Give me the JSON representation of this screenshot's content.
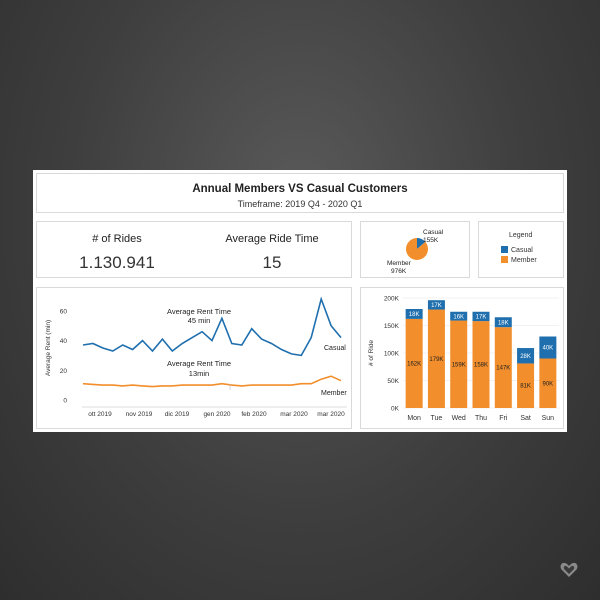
{
  "header": {
    "title": "Annual Members VS Casual Customers",
    "subtitle": "Timeframe: 2019 Q4  - 2020 Q1"
  },
  "kpis": {
    "rides_label": "# of Rides",
    "rides_value": "1.130.941",
    "avg_label": "Average Ride Time",
    "avg_value": "15"
  },
  "legend": {
    "title": "Legend",
    "casual": "Casual",
    "member": "Member"
  },
  "colors": {
    "casual": "#1f6fae",
    "member": "#f28e2b"
  },
  "chart_data": [
    {
      "type": "pie",
      "slices": [
        {
          "name": "Casual",
          "value": 155,
          "label": "155K"
        },
        {
          "name": "Member",
          "value": 976,
          "label": "976K"
        }
      ],
      "labels": {
        "casual_name": "Casual",
        "casual_value": "155K",
        "member_name": "Member",
        "member_value": "976K"
      }
    },
    {
      "type": "line",
      "ylabel": "Average Rent (min)",
      "ylim": [
        0,
        70
      ],
      "yticks": [
        "0",
        "20",
        "40",
        "60"
      ],
      "xticks": [
        "ott 2019",
        "nov 2019",
        "dic 2019",
        "gen 2020",
        "feb 2020",
        "mar 2020",
        "mar 2020"
      ],
      "annotations": {
        "casual_line1": "Average Rent Time",
        "casual_line2": "45 min",
        "member_line1": "Average Rent Time",
        "member_line2": "13min"
      },
      "series": [
        {
          "name": "Casual",
          "values": [
            37,
            38,
            35,
            33,
            37,
            34,
            40,
            33,
            41,
            33,
            38,
            42,
            46,
            40,
            55,
            38,
            37,
            48,
            41,
            38,
            34,
            31,
            30,
            42,
            68,
            50,
            42
          ]
        },
        {
          "name": "Member",
          "values": [
            11,
            10.5,
            10,
            10,
            9.5,
            10,
            9.5,
            9,
            9.5,
            9.5,
            10,
            10,
            10,
            10,
            11,
            10,
            9.5,
            10,
            10,
            10,
            10,
            10,
            11,
            11,
            14,
            16,
            13
          ]
        }
      ]
    },
    {
      "type": "bar",
      "ylabel": "# of Ride",
      "ylim": [
        0,
        200
      ],
      "yticks": [
        "0K",
        "50K",
        "100K",
        "150K",
        "200K"
      ],
      "categories": [
        "Mon",
        "Tue",
        "Wed",
        "Thu",
        "Fri",
        "Sat",
        "Sun"
      ],
      "series": [
        {
          "name": "Member",
          "values": [
            162,
            179,
            159,
            158,
            147,
            81,
            90
          ],
          "labels": [
            "162K",
            "179K",
            "159K",
            "158K",
            "147K",
            "81K",
            "90K"
          ]
        },
        {
          "name": "Casual",
          "values": [
            18,
            17,
            16,
            17,
            18,
            28,
            40
          ],
          "labels": [
            "18K",
            "17K",
            "16K",
            "17K",
            "18K",
            "28K",
            "40K"
          ]
        }
      ]
    }
  ]
}
